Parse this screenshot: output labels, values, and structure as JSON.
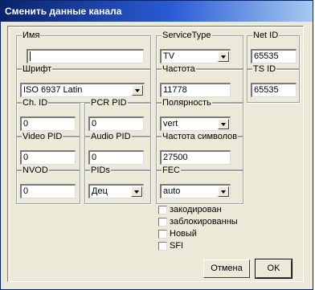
{
  "window": {
    "title": "Сменить данные канала"
  },
  "fields": {
    "name": {
      "label": "Имя",
      "value": ""
    },
    "service_type": {
      "label": "ServiceType",
      "value": "TV"
    },
    "net_id": {
      "label": "Net ID",
      "value": "65535"
    },
    "font": {
      "label": "Шрифт",
      "value": "ISO 6937 Latin"
    },
    "frequency": {
      "label": "Частота",
      "value": "11778"
    },
    "ts_id": {
      "label": "TS ID",
      "value": "65535"
    },
    "ch_id": {
      "label": "Ch. ID",
      "value": "0"
    },
    "pcr_pid": {
      "label": "PCR PID",
      "value": "0"
    },
    "polarity": {
      "label": "Полярность",
      "value": "vert"
    },
    "video_pid": {
      "label": "Video PID",
      "value": "0"
    },
    "audio_pid": {
      "label": "Audio PID",
      "value": "0"
    },
    "symbol_rate": {
      "label": "Частота символов",
      "value": "27500"
    },
    "nvod": {
      "label": "NVOD",
      "value": "0"
    },
    "pids": {
      "label": "PIDs",
      "value": "Дец"
    },
    "fec": {
      "label": "FEC",
      "value": "auto"
    }
  },
  "checkboxes": [
    {
      "label": "закодирован",
      "checked": false
    },
    {
      "label": "заблокированны",
      "checked": false
    },
    {
      "label": "Новый",
      "checked": false
    },
    {
      "label": "SFI",
      "checked": false
    }
  ],
  "buttons": {
    "cancel": "Отмена",
    "ok": "OK"
  },
  "colors": {
    "titlebar_start": "#0a246a",
    "titlebar_end": "#a6caf0",
    "dialog_bg": "#ece9d8"
  }
}
